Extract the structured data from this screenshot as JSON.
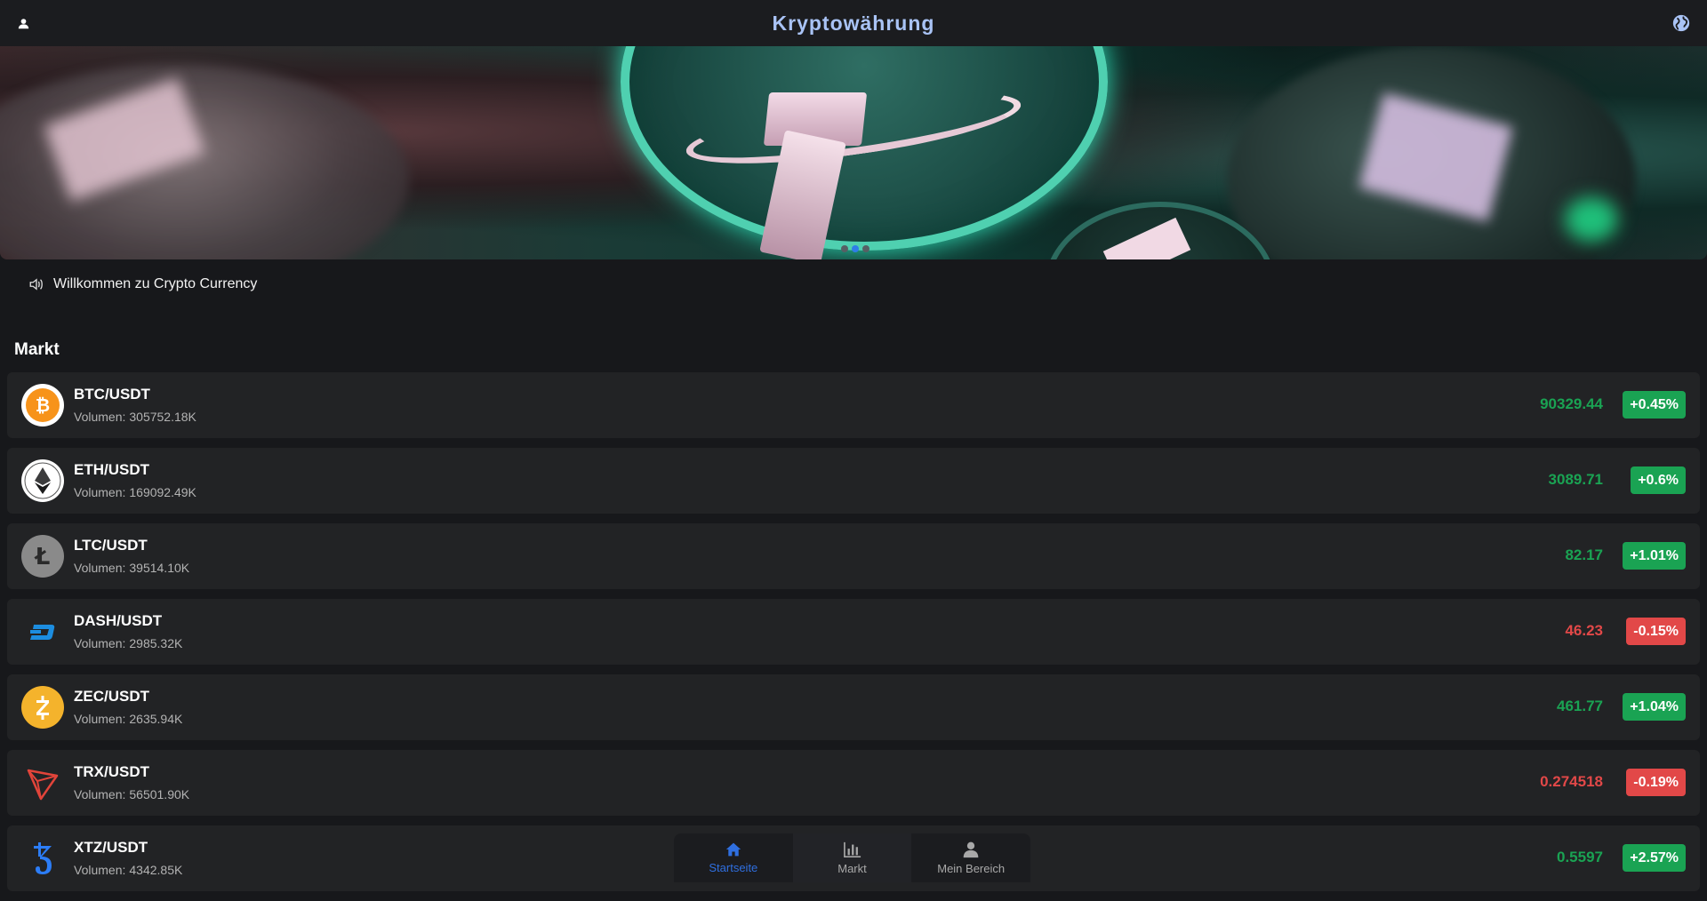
{
  "header": {
    "title": "Kryptowährung",
    "user_icon": "user-icon",
    "globe_icon": "globe-icon"
  },
  "banner": {
    "slides": 3,
    "active_slide": 1
  },
  "notice": {
    "icon": "speaker-icon",
    "text": "Willkommen zu Crypto Currency"
  },
  "market": {
    "title": "Markt",
    "volume_label": "Volumen:",
    "rows": [
      {
        "pair": "BTC/USDT",
        "volume": "305752.18K",
        "price": "90329.44",
        "change": "+0.45%",
        "trend": "up",
        "icon": "bitcoin-icon",
        "color": "#f7931a"
      },
      {
        "pair": "ETH/USDT",
        "volume": "169092.49K",
        "price": "3089.71",
        "change": "+0.6%",
        "trend": "up",
        "icon": "ethereum-icon",
        "color": "#ffffff"
      },
      {
        "pair": "LTC/USDT",
        "volume": "39514.10K",
        "price": "82.17",
        "change": "+1.01%",
        "trend": "up",
        "icon": "litecoin-icon",
        "color": "#8a8a8a"
      },
      {
        "pair": "DASH/USDT",
        "volume": "2985.32K",
        "price": "46.23",
        "change": "-0.15%",
        "trend": "down",
        "icon": "dash-icon",
        "color": "#1c8de0"
      },
      {
        "pair": "ZEC/USDT",
        "volume": "2635.94K",
        "price": "461.77",
        "change": "+1.04%",
        "trend": "up",
        "icon": "zcash-icon",
        "color": "#f4b32c"
      },
      {
        "pair": "TRX/USDT",
        "volume": "56501.90K",
        "price": "0.274518",
        "change": "-0.19%",
        "trend": "down",
        "icon": "tron-icon",
        "color": "#e2443a"
      },
      {
        "pair": "XTZ/USDT",
        "volume": "4342.85K",
        "price": "0.5597",
        "change": "+2.57%",
        "trend": "up",
        "icon": "tezos-icon",
        "color": "#2c7df7"
      }
    ]
  },
  "bottom_nav": {
    "items": [
      {
        "label": "Startseite",
        "icon": "home-icon",
        "active": true
      },
      {
        "label": "Markt",
        "icon": "chart-icon",
        "active": false
      },
      {
        "label": "Mein Bereich",
        "icon": "person-icon",
        "active": false
      }
    ]
  },
  "colors": {
    "accent": "#2f6fe0",
    "up": "#1aa353",
    "down": "#e24848",
    "title": "#a9c3f5"
  }
}
